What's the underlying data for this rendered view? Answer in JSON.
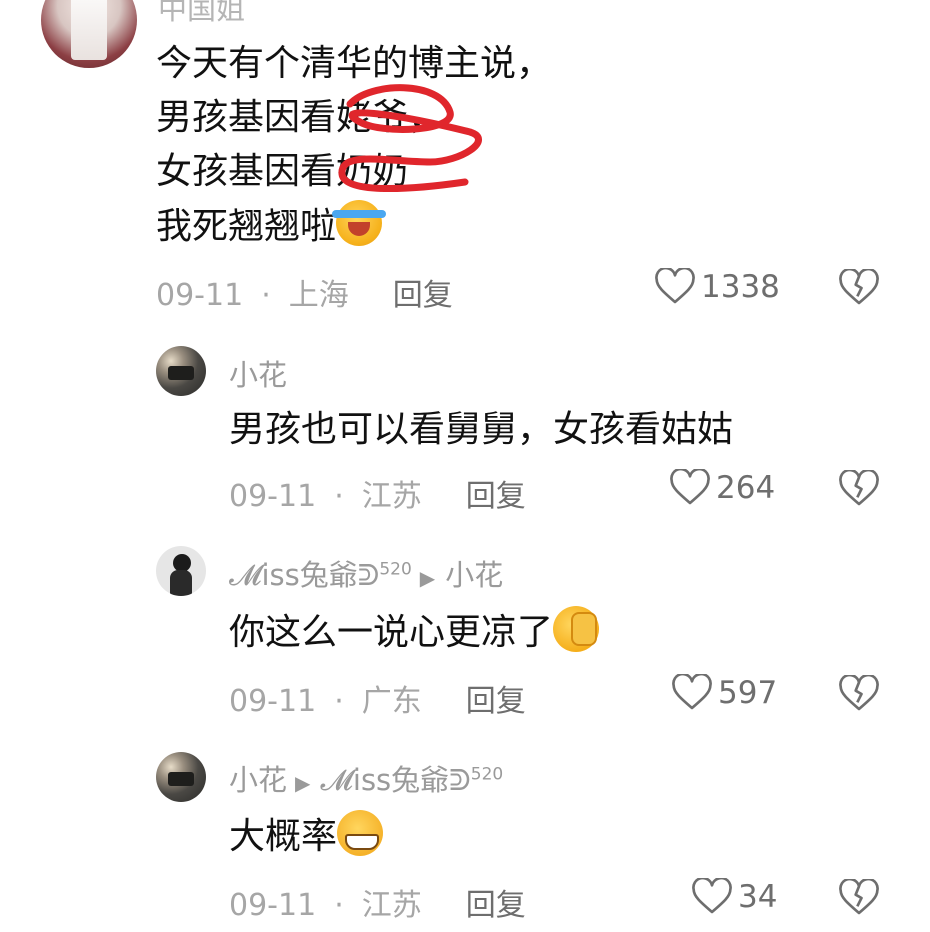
{
  "main_comment": {
    "username_cut": "中国姐",
    "lines": [
      "今天有个清华的博主说，",
      "男孩基因看姥爷，",
      "女孩基因看奶奶",
      "我死翘翘啦"
    ],
    "emoji": "loudly-crying-face",
    "date": "09-11",
    "location": "上海",
    "reply": "回复",
    "likes": "1338"
  },
  "replies": [
    {
      "username": "小花",
      "reply_to": "",
      "text": "男孩也可以看舅舅，女孩看姑姑",
      "emoji": "",
      "date": "09-11",
      "location": "江苏",
      "reply": "回复",
      "likes": "264"
    },
    {
      "username": "𝓜iss兔爺ᕲ",
      "username_sup": "520",
      "reply_to": "小花",
      "text": "你这么一说心更凉了",
      "emoji": "face-with-hand-over-eyes",
      "date": "09-11",
      "location": "广东",
      "reply": "回复",
      "likes": "597"
    },
    {
      "username": "小花",
      "reply_to": "𝓜iss兔爺ᕲ",
      "reply_to_sup": "520",
      "text": "大概率",
      "emoji": "grimacing-face",
      "date": "09-11",
      "location": "江苏",
      "reply": "回复",
      "likes": "34"
    }
  ],
  "colors": {
    "meta": "#a6a6a6",
    "annotation": "#e0262c"
  }
}
